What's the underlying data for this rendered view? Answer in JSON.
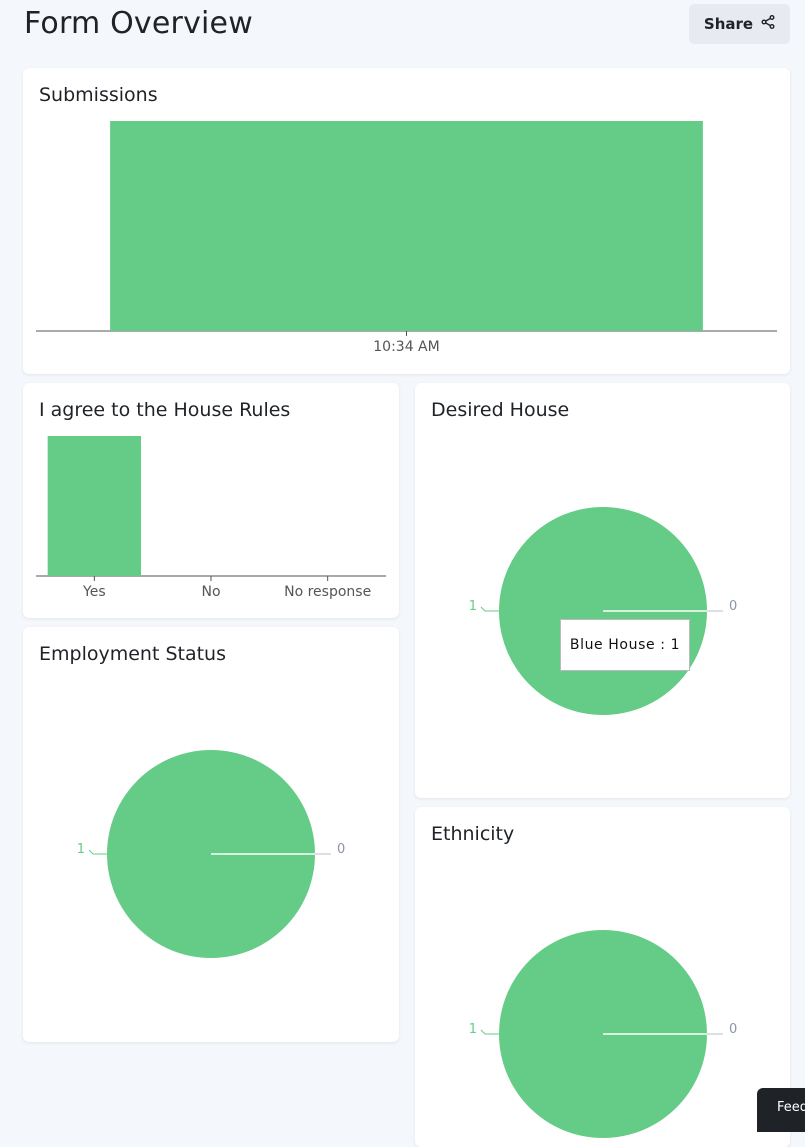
{
  "page": {
    "title": "Form Overview"
  },
  "header": {
    "share_label": "Share"
  },
  "colors": {
    "bar": "#64cc86",
    "axis": "#555555",
    "pie": "#64cc86",
    "leader_zero": "#b8c2cc",
    "label_green": "#64cc86"
  },
  "feedback": {
    "label": "Feed"
  },
  "chart_data": [
    {
      "type": "bar",
      "title": "Submissions",
      "categories": [
        "10:34 AM"
      ],
      "values": [
        1
      ],
      "ylim": [
        0,
        1
      ],
      "grid": false
    },
    {
      "type": "bar",
      "title": "I agree to the House Rules",
      "categories": [
        "Yes",
        "No",
        "No response"
      ],
      "values": [
        1,
        0,
        0
      ],
      "ylim": [
        0,
        1
      ],
      "grid": false
    },
    {
      "type": "pie",
      "title": "Desired House",
      "slice_labels": [
        "1",
        "0"
      ],
      "values": [
        1,
        0
      ],
      "tooltip": "Blue House : 1"
    },
    {
      "type": "pie",
      "title": "Employment Status",
      "slice_labels": [
        "1",
        "0"
      ],
      "values": [
        1,
        0
      ]
    },
    {
      "type": "pie",
      "title": "Ethnicity",
      "slice_labels": [
        "1",
        "0"
      ],
      "values": [
        1,
        0
      ]
    }
  ]
}
